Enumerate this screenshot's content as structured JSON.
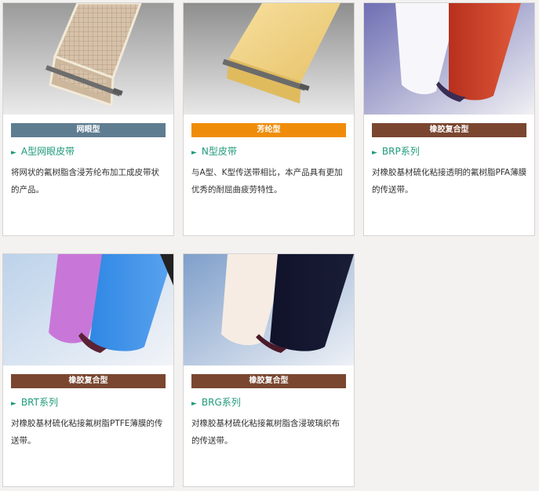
{
  "colors": {
    "mesh_bar": "#5f7d91",
    "aramid_bar": "#ef8d0a",
    "rubber_bar": "#7a4630",
    "link": "#1f9a7a"
  },
  "products": [
    {
      "category": "网眼型",
      "name": "A型网眼皮带",
      "description": "将网状的氟树脂含浸芳纶布加工成皮带状的产品。",
      "image_icon": "mesh-belt-image"
    },
    {
      "category": "芳纶型",
      "name": "N型皮带",
      "description": "与A型、K型传送带相比，本产品具有更加优秀的耐屈曲疲劳特性。",
      "image_icon": "yellow-belt-image"
    },
    {
      "category": "橡胶复合型",
      "name": "BRP系列",
      "description": "对橡胶基材硫化粘接透明的氟树脂PFA薄膜的传送带。",
      "image_icon": "white-red-belt-image"
    },
    {
      "category": "橡胶复合型",
      "name": "BRT系列",
      "description": "对橡胶基材硫化粘接氟树脂PTFE薄膜的传送带。",
      "image_icon": "pink-blue-belt-image"
    },
    {
      "category": "橡胶复合型",
      "name": "BRG系列",
      "description": "对橡胶基材硫化粘接氟树脂含浸玻璃织布的传送带。",
      "image_icon": "white-black-belt-image"
    }
  ]
}
